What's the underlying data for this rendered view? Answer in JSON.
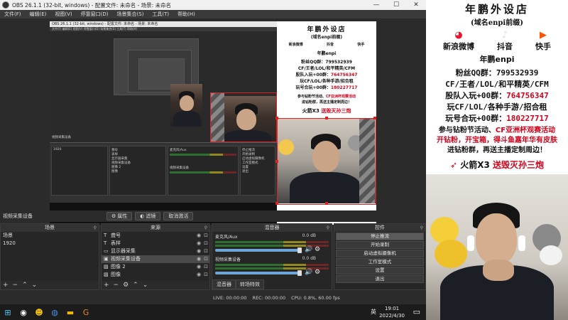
{
  "window": {
    "title": "OBS 26.1.1 (32-bit, windows) - 配置文件: 未命名 - 场景: 未命名",
    "minimize": "—",
    "maximize": "☐",
    "close": "✕"
  },
  "menu": [
    "文件(F)",
    "编辑(E)",
    "视图(V)",
    "停靠窗口(D)",
    "场景集合(S)",
    "工具(T)",
    "帮助(H)"
  ],
  "dockbar": {
    "source_name": "视频采集设备",
    "properties": "属性",
    "filters": "滤镜",
    "deactivate": "取消激活"
  },
  "scenes": {
    "header": "场景",
    "items": [
      "场景",
      "1920"
    ]
  },
  "sources": {
    "header": "来源",
    "items": [
      {
        "icon": "T",
        "label": "聋号"
      },
      {
        "icon": "T",
        "label": "表样"
      },
      {
        "icon": "▭",
        "label": "显示器采集"
      },
      {
        "icon": "▣",
        "label": "视频采集设备"
      },
      {
        "icon": "▨",
        "label": "图像 2"
      },
      {
        "icon": "▨",
        "label": "图像"
      }
    ]
  },
  "mixer": {
    "header": "混音器",
    "channels": [
      {
        "name": "麦克风/Aux",
        "db": "0.0 dB",
        "level": 0.85
      },
      {
        "name": "视频采集设备",
        "db": "0.0 dB",
        "level": 0.85
      }
    ],
    "tabs": [
      "混音器",
      "转场特效"
    ]
  },
  "controls": {
    "header": "控件",
    "buttons": [
      "停止推流",
      "开始录制",
      "启动虚拟摄像机",
      "工作室模式",
      "设置",
      "退出"
    ]
  },
  "status": {
    "live": "LIVE: 00:00:00",
    "rec": "REC: 00:00:00",
    "cpu": "CPU: 0.8%, 60.00 fps"
  },
  "taskbar": {
    "lang": "英",
    "time": "19:01",
    "date": "2022/4/30"
  },
  "nested": {
    "title": "OBS 26.1.1 (32-bit, windows) - 配置文件: 未命名 - 场景: 未命名",
    "menu": "文件(F) 编辑(E) 视图(V) 停靠窗口(D) 场景集合(S) 工具(T) 帮助(H)",
    "source_name": "视频采集设备",
    "scene_item": "1920",
    "sources": [
      "聋号",
      "表样",
      "显示器采集",
      "视频采集设备",
      "图像 2",
      "图像"
    ],
    "mix1": "麦克风/Aux",
    "mix2": "视频采集设备",
    "ctrl": [
      "停止推流",
      "开始录制",
      "启动虚拟摄像机",
      "工作室模式",
      "设置",
      "退出"
    ]
  },
  "overlay": {
    "title": "年鹏外设店",
    "subtitle": "(域名enpi前缀)",
    "socials": [
      {
        "icon": "weibo-icon",
        "label": "新浪微博"
      },
      {
        "icon": "tiktok-icon",
        "label": "抖音"
      },
      {
        "icon": "kuaishou-icon",
        "label": "快手"
      }
    ],
    "handle": "年鹏enpi",
    "qq_label": "粉丝QQ群：",
    "qq_number": "799532939",
    "games": "CF/王者/LOL/和平精英/CFM",
    "join_label": "股队入玩+00群：",
    "join_number": "764756347",
    "games2": "玩CF/LOL/各种手游/招合租",
    "fun_label": "玩号合玩+00群：",
    "fun_number": "180227717",
    "promo1_a": "参与钻粉节活动、",
    "promo1_b": "CF亚洲杯观赛活动",
    "promo2_a": "开钻粉，",
    "promo2_b": "开宝箱，",
    "promo2_c": "得斗鱼嘉年华有皮肤",
    "promo3": "进钻粉群，再送主播定制周边！",
    "banner_a": "火箭X3",
    "banner_b": "送毁灭孙三炮"
  }
}
